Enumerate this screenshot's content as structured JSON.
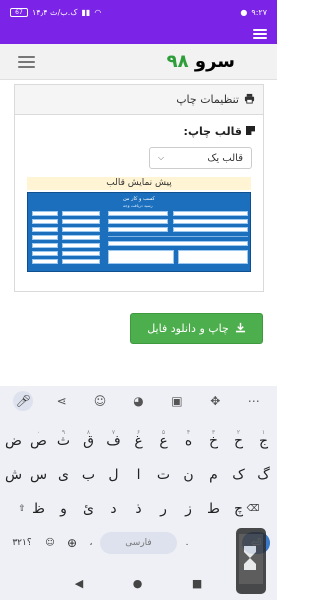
{
  "status_bar": {
    "time": "۹:۲۷",
    "indicators": "۱۴٫۴ ک.ب/ث",
    "battery": "67"
  },
  "header": {
    "logo_text": "سرو",
    "logo_number": "۹۸"
  },
  "panel": {
    "title": "تنظیمات چاپ",
    "template_label": "قالب چاپ:",
    "template_select_value": "قالب یک",
    "preview_title": "پیش نمایش قالب",
    "receipt": {
      "shop_name": "کسب و کار من",
      "subtitle": "رسید دریافت وجه"
    }
  },
  "download_button_label": "چاپ و دانلود فایل",
  "keyboard": {
    "row1": [
      "ج",
      "ح",
      "خ",
      "ه",
      "ع",
      "غ",
      "ف",
      "ق",
      "ث",
      "ص",
      "ض"
    ],
    "row1_hints": [
      "۱",
      "۲",
      "۳",
      "۴",
      "۵",
      "۶",
      "۷",
      "۸",
      "۹",
      "۰",
      ""
    ],
    "row2": [
      "گ",
      "ک",
      "م",
      "ن",
      "ت",
      "ا",
      "ل",
      "ب",
      "ی",
      "س",
      "ش"
    ],
    "row3": [
      "چ",
      "ط",
      "ز",
      "ر",
      "ذ",
      "د",
      "ئ",
      "و",
      "ظ"
    ],
    "numbers_key": "۳۲۱؟",
    "space_label": "فارسی",
    "comma_key": "،",
    "period_key": "."
  },
  "colors": {
    "status_bar": "#7b23e6",
    "download_button": "#4cae4c",
    "receipt": "#1c6fbd",
    "enter_key": "#3a78c9"
  }
}
